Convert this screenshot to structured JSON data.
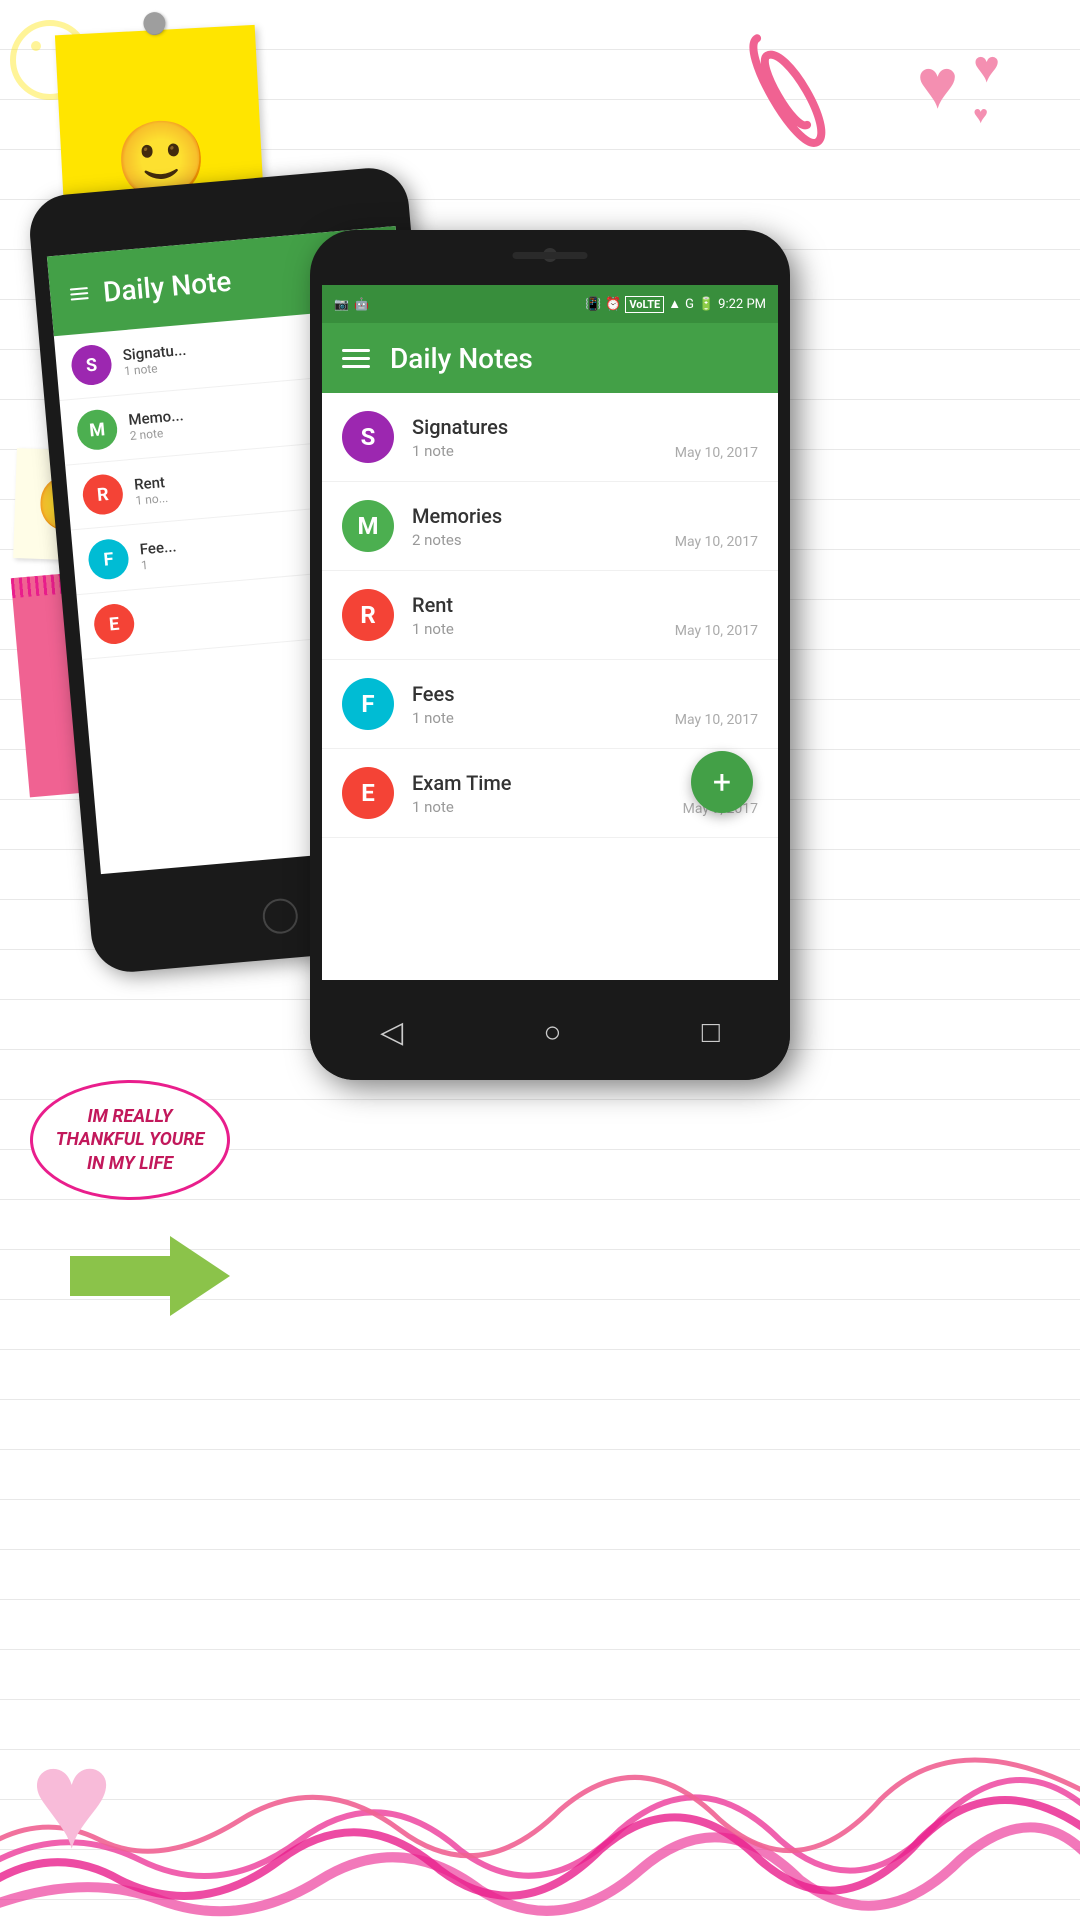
{
  "app": {
    "title": "Daily Notes",
    "time": "9:22 PM"
  },
  "status_bar": {
    "time": "9:22 PM",
    "icons": [
      "instagram",
      "android",
      "vibrate",
      "alarm",
      "volte",
      "battery",
      "signal"
    ]
  },
  "notes": [
    {
      "id": 1,
      "letter": "S",
      "title": "Signatures",
      "count": "1 note",
      "date": "May 10, 2017",
      "color": "#9C27B0"
    },
    {
      "id": 2,
      "letter": "M",
      "title": "Memories",
      "count": "2 notes",
      "date": "May 10, 2017",
      "color": "#4CAF50"
    },
    {
      "id": 3,
      "letter": "R",
      "title": "Rent",
      "count": "1 note",
      "date": "May 10, 2017",
      "color": "#F44336"
    },
    {
      "id": 4,
      "letter": "F",
      "title": "Fees",
      "count": "1 note",
      "date": "May 10, 2017",
      "color": "#00BCD4"
    },
    {
      "id": 5,
      "letter": "E",
      "title": "Exam Time",
      "count": "1 note",
      "date": "May 9, 2017",
      "color": "#F44336"
    }
  ],
  "fab": {
    "label": "+"
  },
  "speech_bubble": {
    "text": "IM REALLY THANKFUL YOURE IN MY LIFE"
  },
  "decorations": {
    "smiley": "☺",
    "small_smiley": "☺"
  }
}
